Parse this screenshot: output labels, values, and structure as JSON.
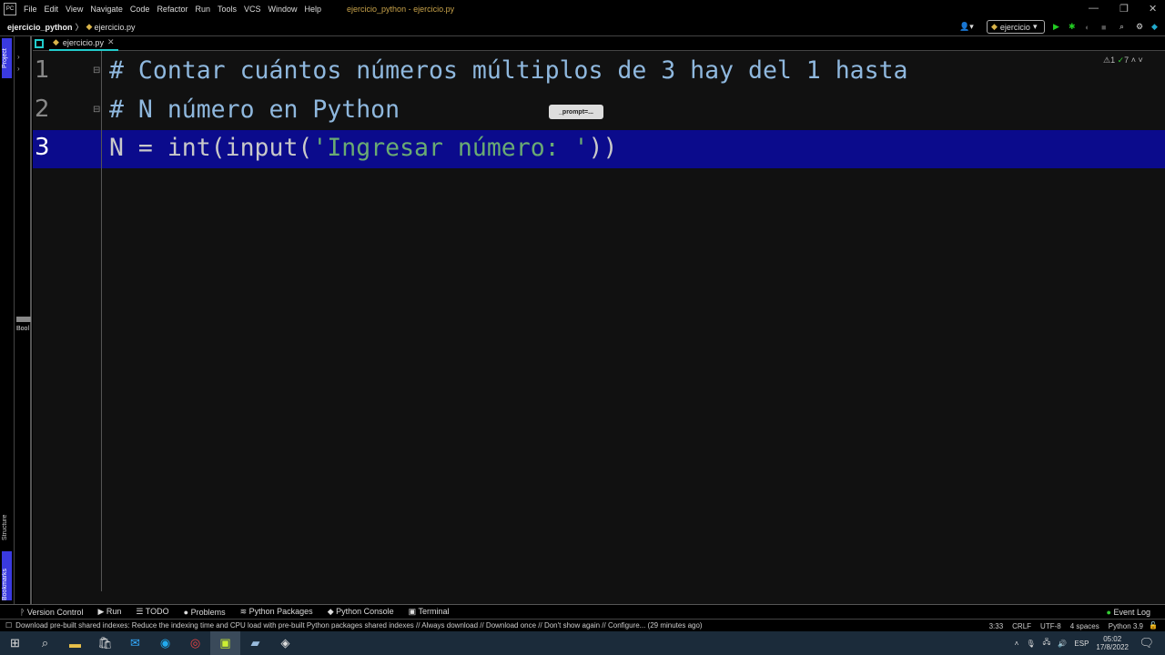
{
  "menubar": {
    "items": [
      "File",
      "Edit",
      "View",
      "Navigate",
      "Code",
      "Refactor",
      "Run",
      "Tools",
      "VCS",
      "Window",
      "Help"
    ],
    "title": "ejercicio_python - ejercicio.py"
  },
  "breadcrumb": {
    "project": "ejercicio_python",
    "file": "ejercicio.py"
  },
  "toolbar": {
    "run_config": "ejercicio"
  },
  "sidebar": {
    "project": "Project",
    "structure": "Structure",
    "bookmarks": "Bookmarks",
    "bookmarks_panel": "Bool"
  },
  "tab": {
    "label": "ejercicio.py"
  },
  "inspections": {
    "warnings": "1",
    "typos": "7"
  },
  "editor": {
    "lines": [
      {
        "number": "1",
        "text": "# Contar cuántos números múltiplos de 3 hay del 1 hasta"
      },
      {
        "number": "2",
        "text": "# N número en Python"
      },
      {
        "number": "3",
        "pre": "N = int(input(",
        "str": "'Ingresar número: '",
        "post": "))"
      }
    ],
    "param_hint": "_prompt=..."
  },
  "bottom_tools": [
    "Version Control",
    "Run",
    "TODO",
    "Problems",
    "Python Packages",
    "Python Console",
    "Terminal"
  ],
  "event_log": "Event Log",
  "status": {
    "message": "Download pre-built shared indexes: Reduce the indexing time and CPU load with pre-built Python packages shared indexes // Always download // Download once // Don't show again // Configure... (29 minutes ago)",
    "position": "3:33",
    "line_sep": "CRLF",
    "encoding": "UTF-8",
    "indent": "4 spaces",
    "interpreter": "Python 3.9"
  },
  "taskbar": {
    "lang": "ESP",
    "time": "05:02",
    "date": "17/8/2022"
  },
  "colors": {
    "highlight": "#0b0b8c",
    "accent": "#3a3ae0"
  }
}
